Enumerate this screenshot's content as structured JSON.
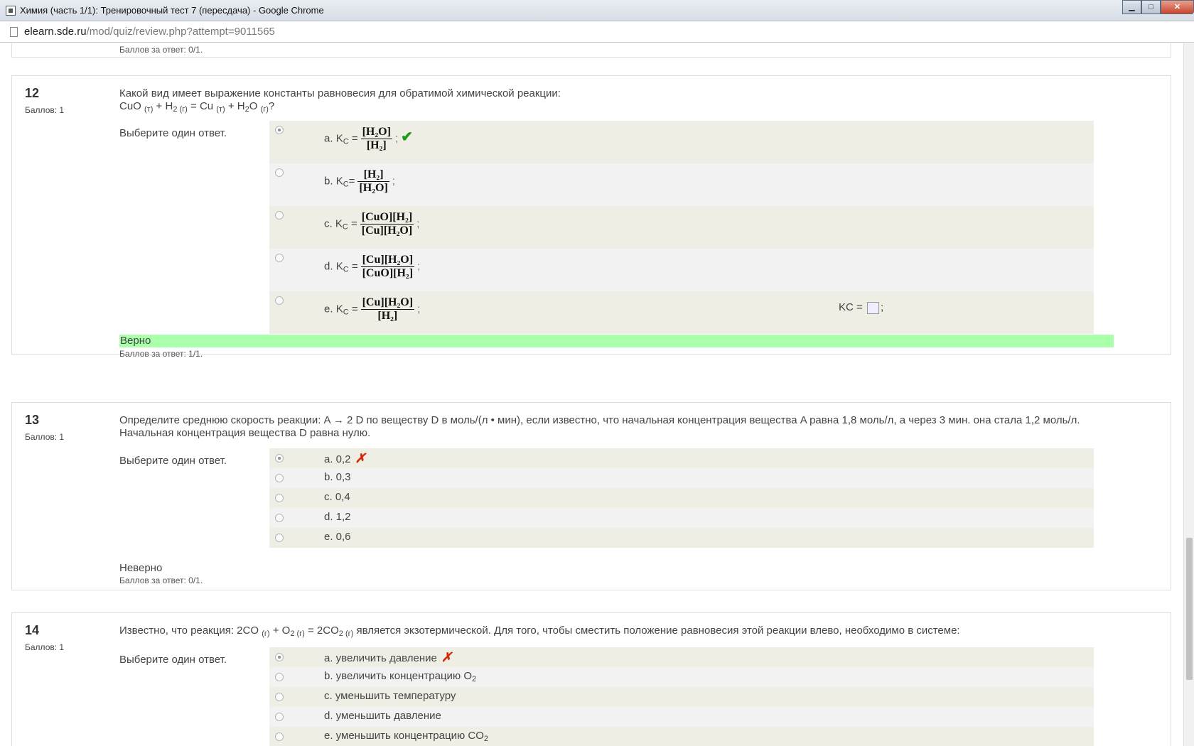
{
  "window": {
    "title": "Химия (часть 1/1): Тренировочный тест 7 (пересдача) - Google Chrome",
    "buttons": {
      "minimize": "▁",
      "maximize": "□",
      "close": "✕"
    }
  },
  "address": {
    "host": "elearn.sde.ru",
    "path": "/mod/quiz/review.php?attempt=9011565"
  },
  "prev_question": {
    "score": "Баллов за ответ: 0/1."
  },
  "questions": [
    {
      "number": "12",
      "marks": "Баллов: 1",
      "text_line1": "Какой вид имеет выражение константы равновесия для обратимой химической реакции:",
      "equation": {
        "p1": "CuO",
        "s1": "(т)",
        "p2": " + H",
        "s2": "2 (г)",
        "p3": " = Cu",
        "s3": "(т)",
        "p4": " + H",
        "s4": "2",
        "p5": "O",
        "s5": "(г)",
        "p6": "?"
      },
      "prompt": "Выберите один ответ.",
      "answers": [
        {
          "letter": "a.",
          "kc": "K",
          "kc_sub": "C",
          "eq": "=",
          "num": "[H₂O]",
          "den": "[H₂]",
          "semi": ";",
          "mark": "✔",
          "checked": true
        },
        {
          "letter": "b.",
          "kc": "K",
          "kc_sub": "C",
          "eq": "=",
          "num": "[H₂]",
          "den": "[H₂O]",
          "semi": ";",
          "mark": "",
          "checked": false
        },
        {
          "letter": "c.",
          "kc": "K",
          "kc_sub": "C",
          "eq": "=",
          "num": "[CuO][H₂]",
          "den": "[Cu][H₂O]",
          "semi": ";",
          "mark": "",
          "checked": false
        },
        {
          "letter": "d.",
          "kc": "K",
          "kc_sub": "C",
          "eq": "=",
          "num": "[Cu][H₂O]",
          "den": "[CuO][H₂]",
          "semi": ";",
          "mark": "",
          "checked": false
        },
        {
          "letter": "e.",
          "kc": "K",
          "kc_sub": "C",
          "eq": "=",
          "num": "[Cu][H₂O]",
          "den": "[H₂]",
          "semi": ";",
          "mark": "",
          "checked": false
        }
      ],
      "extra_kc": {
        "label": "KC =",
        "semi": ";"
      },
      "outcome": "Верно",
      "score": "Баллов за ответ: 1/1."
    },
    {
      "number": "13",
      "marks": "Баллов: 1",
      "text": "Определите среднюю скорость реакции: A → 2 D по веществу D в моль/(л • мин), если известно, что начальная концентрация вещества A равна 1,8 моль/л, а через 3 мин. она стала 1,2 моль/л. Начальная концентрация вещества D равна нулю.",
      "prompt": "Выберите один ответ.",
      "answers": [
        {
          "label": "a. 0,2",
          "mark": "✗"
        },
        {
          "label": "b. 0,3",
          "mark": ""
        },
        {
          "label": "c. 0,4",
          "mark": ""
        },
        {
          "label": "d. 1,2",
          "mark": ""
        },
        {
          "label": "e. 0,6",
          "mark": ""
        }
      ],
      "outcome": "Неверно",
      "score": "Баллов за ответ: 0/1."
    },
    {
      "number": "14",
      "marks": "Баллов: 1",
      "text": {
        "p1": "Известно, что реакция: 2CO",
        "s1": "(г)",
        "p2": " + O",
        "s2": "2 (г)",
        "p3": " = 2CO",
        "s3": "2 (г)",
        "p4": " является экзотермической. Для того, чтобы сместить положение равновесия этой реакции влево, необходимо в системе:"
      },
      "prompt": "Выберите один ответ.",
      "answers": [
        {
          "label": "a. увеличить давление",
          "sub": "",
          "mark": "✗"
        },
        {
          "label": "b. увеличить концентрацию O",
          "sub": "2",
          "mark": ""
        },
        {
          "label": "c. уменьшить температуру",
          "sub": "",
          "mark": ""
        },
        {
          "label": "d. уменьшить давление",
          "sub": "",
          "mark": ""
        },
        {
          "label": "e. уменьшить концентрацию CO",
          "sub": "2",
          "mark": ""
        }
      ]
    }
  ],
  "colors": {
    "correct_bg": "#aaffaa",
    "check": "#1a9a1a",
    "cross": "#d32c0c",
    "answer_bg": "#eeeee4"
  }
}
